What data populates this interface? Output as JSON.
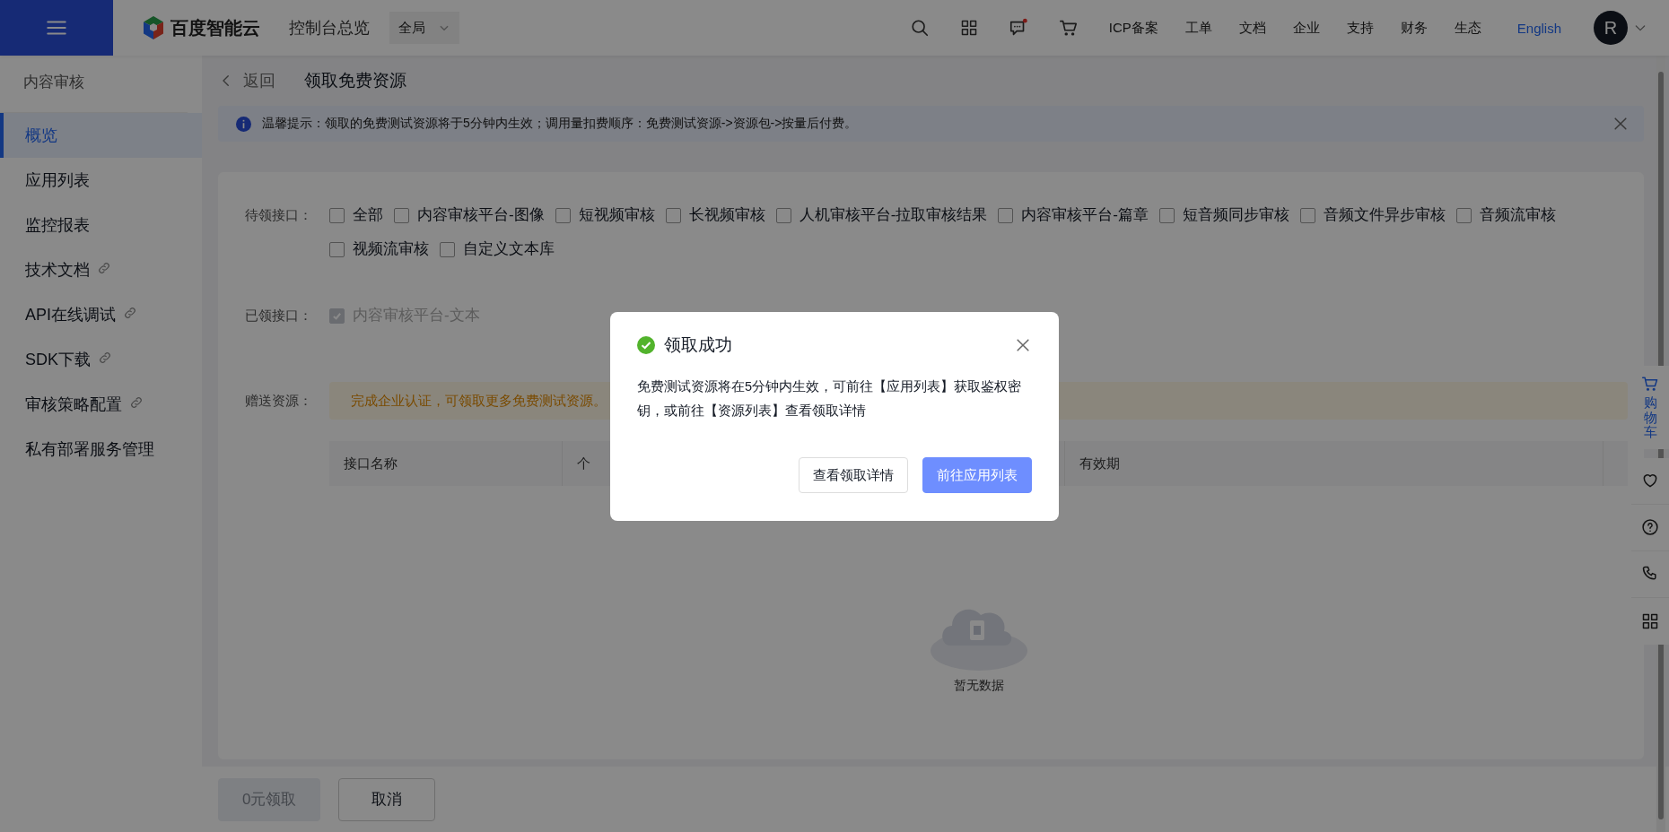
{
  "header": {
    "logo_text": "百度智能云",
    "console_link": "控制台总览",
    "region_select": "全局",
    "nav": [
      "ICP备案",
      "工单",
      "文档",
      "企业",
      "支持",
      "财务",
      "生态"
    ],
    "language": "English",
    "avatar": "R",
    "message_unread": true
  },
  "sidebar": {
    "title": "内容审核",
    "items": [
      {
        "label": "概览",
        "selected": true,
        "external": false
      },
      {
        "label": "应用列表",
        "selected": false,
        "external": false
      },
      {
        "label": "监控报表",
        "selected": false,
        "external": false
      },
      {
        "label": "技术文档",
        "selected": false,
        "external": true
      },
      {
        "label": "API在线调试",
        "selected": false,
        "external": true
      },
      {
        "label": "SDK下载",
        "selected": false,
        "external": true
      },
      {
        "label": "审核策略配置",
        "selected": false,
        "external": true
      },
      {
        "label": "私有部署服务管理",
        "selected": false,
        "external": false
      }
    ]
  },
  "page": {
    "back": "返回",
    "title": "领取免费资源"
  },
  "notice": {
    "text": "温馨提示：领取的免费测试资源将于5分钟内生效；调用量扣费顺序：免费测试资源->资源包->按量后付费。"
  },
  "form": {
    "pending_label": "待领接口：",
    "pending_options": [
      {
        "label": "全部",
        "checked": false
      },
      {
        "label": "内容审核平台-图像",
        "checked": false
      },
      {
        "label": "短视频审核",
        "checked": false
      },
      {
        "label": "长视频审核",
        "checked": false
      },
      {
        "label": "人机审核平台-拉取审核结果",
        "checked": false
      },
      {
        "label": "内容审核平台-篇章",
        "checked": false
      },
      {
        "label": "短音频同步审核",
        "checked": false
      },
      {
        "label": "音频文件异步审核",
        "checked": false
      },
      {
        "label": "音频流审核",
        "checked": false
      },
      {
        "label": "视频流审核",
        "checked": false
      },
      {
        "label": "自定义文本库",
        "checked": false
      }
    ],
    "received_label": "已领接口：",
    "received_options": [
      {
        "label": "内容审核平台-文本",
        "checked": true,
        "disabled": true
      }
    ],
    "gift_label": "赠送资源：",
    "gift_notice": "完成企业认证，可领取更多免费测试资源。",
    "table": {
      "columns": [
        "接口名称",
        "个",
        "有效期"
      ],
      "empty_text": "暂无数据"
    }
  },
  "footer_buttons": [
    {
      "label": "0元领取",
      "disabled": true
    },
    {
      "label": "取消",
      "disabled": false
    }
  ],
  "floating_bar": {
    "cart_label": "购物车"
  },
  "dialog": {
    "title": "领取成功",
    "body": "免费测试资源将在5分钟内生效，可前往【应用列表】获取鉴权密钥，或前往【资源列表】查看领取详情",
    "buttons": [
      {
        "label": "查看领取详情",
        "kind": "secondary"
      },
      {
        "label": "前往应用列表",
        "kind": "primary"
      }
    ]
  }
}
